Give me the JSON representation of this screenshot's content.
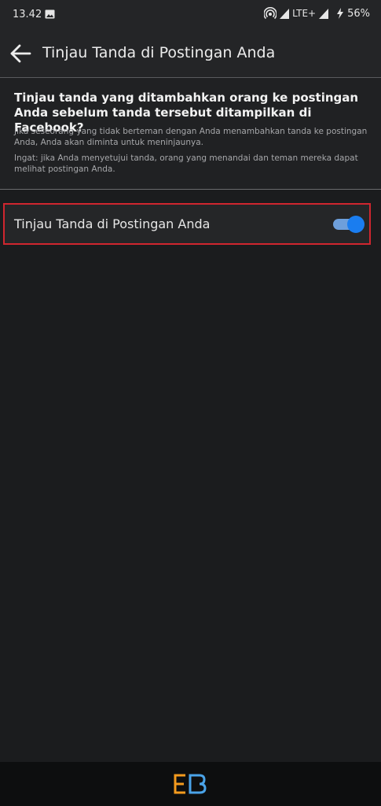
{
  "status_bar": {
    "time": "13.42",
    "network": "LTE+",
    "battery": "56%",
    "icons": [
      "image-icon",
      "hotspot-icon",
      "signal-icon",
      "signal-icon-2",
      "charging-icon"
    ]
  },
  "app_bar": {
    "title": "Tinjau Tanda di Postingan Anda",
    "back_icon": "arrow-left-icon"
  },
  "info": {
    "heading": "Tinjau tanda yang ditambahkan orang ke postingan Anda sebelum tanda tersebut ditampilkan di Facebook?",
    "description": "Jika seseorang yang tidak berteman dengan Anda menambahkan tanda ke postingan Anda, Anda akan diminta untuk meninjaunya.",
    "note": "Ingat: jika Anda menyetujui tanda, orang yang menandai dan teman mereka dapat melihat postingan Anda."
  },
  "setting": {
    "label": "Tinjau Tanda di Postingan Anda",
    "enabled": true
  },
  "colors": {
    "accent": "#1a7df0",
    "highlight_border": "#d0262f",
    "logo_orange": "#f39a1e",
    "logo_blue": "#4aa3e8"
  }
}
